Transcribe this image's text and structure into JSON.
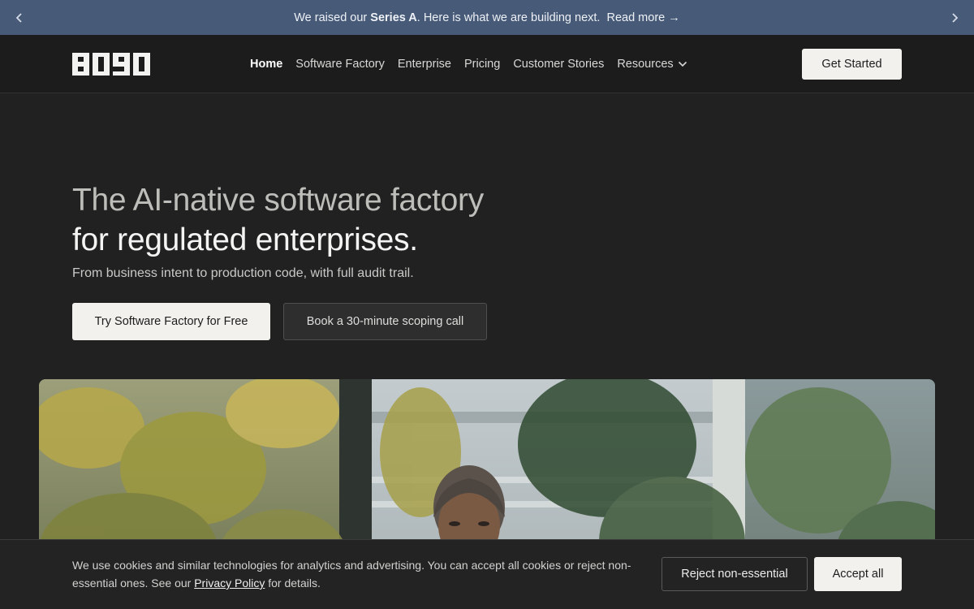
{
  "announcement": {
    "prefix": "We raised our ",
    "highlight": "Series A",
    "suffix": ". Here is what we are building next.",
    "link": "Read more →",
    "prev_icon": "chevron-left-icon",
    "next_icon": "chevron-right-icon"
  },
  "nav": {
    "logo_text": "8090",
    "items": [
      {
        "label": "Home",
        "active": true
      },
      {
        "label": "Software Factory"
      },
      {
        "label": "Enterprise"
      },
      {
        "label": "Pricing"
      },
      {
        "label": "Customer Stories"
      },
      {
        "label": "Resources",
        "icon": "chevron-down-icon"
      }
    ],
    "cta": "Get Started"
  },
  "hero": {
    "title_line1": "The AI-native software factory",
    "title_line2": "for regulated enterprises.",
    "subtitle": "From business intent to production code, with full audit trail.",
    "primary_cta": "Try Software Factory for Free",
    "secondary_cta": "Book a 30-minute scoping call"
  },
  "cookie": {
    "text_before": "We use cookies and similar technologies for analytics and advertising. You can accept all cookies or reject non-essential ones. See our ",
    "link": "Privacy Policy",
    "text_after": " for details.",
    "reject": "Reject non-essential",
    "accept": "Accept all"
  },
  "colors": {
    "announcement_bg": "#475a78",
    "page_bg": "#212121",
    "nav_bg": "#1c1c1c",
    "button_light": "#f2f1ee"
  }
}
